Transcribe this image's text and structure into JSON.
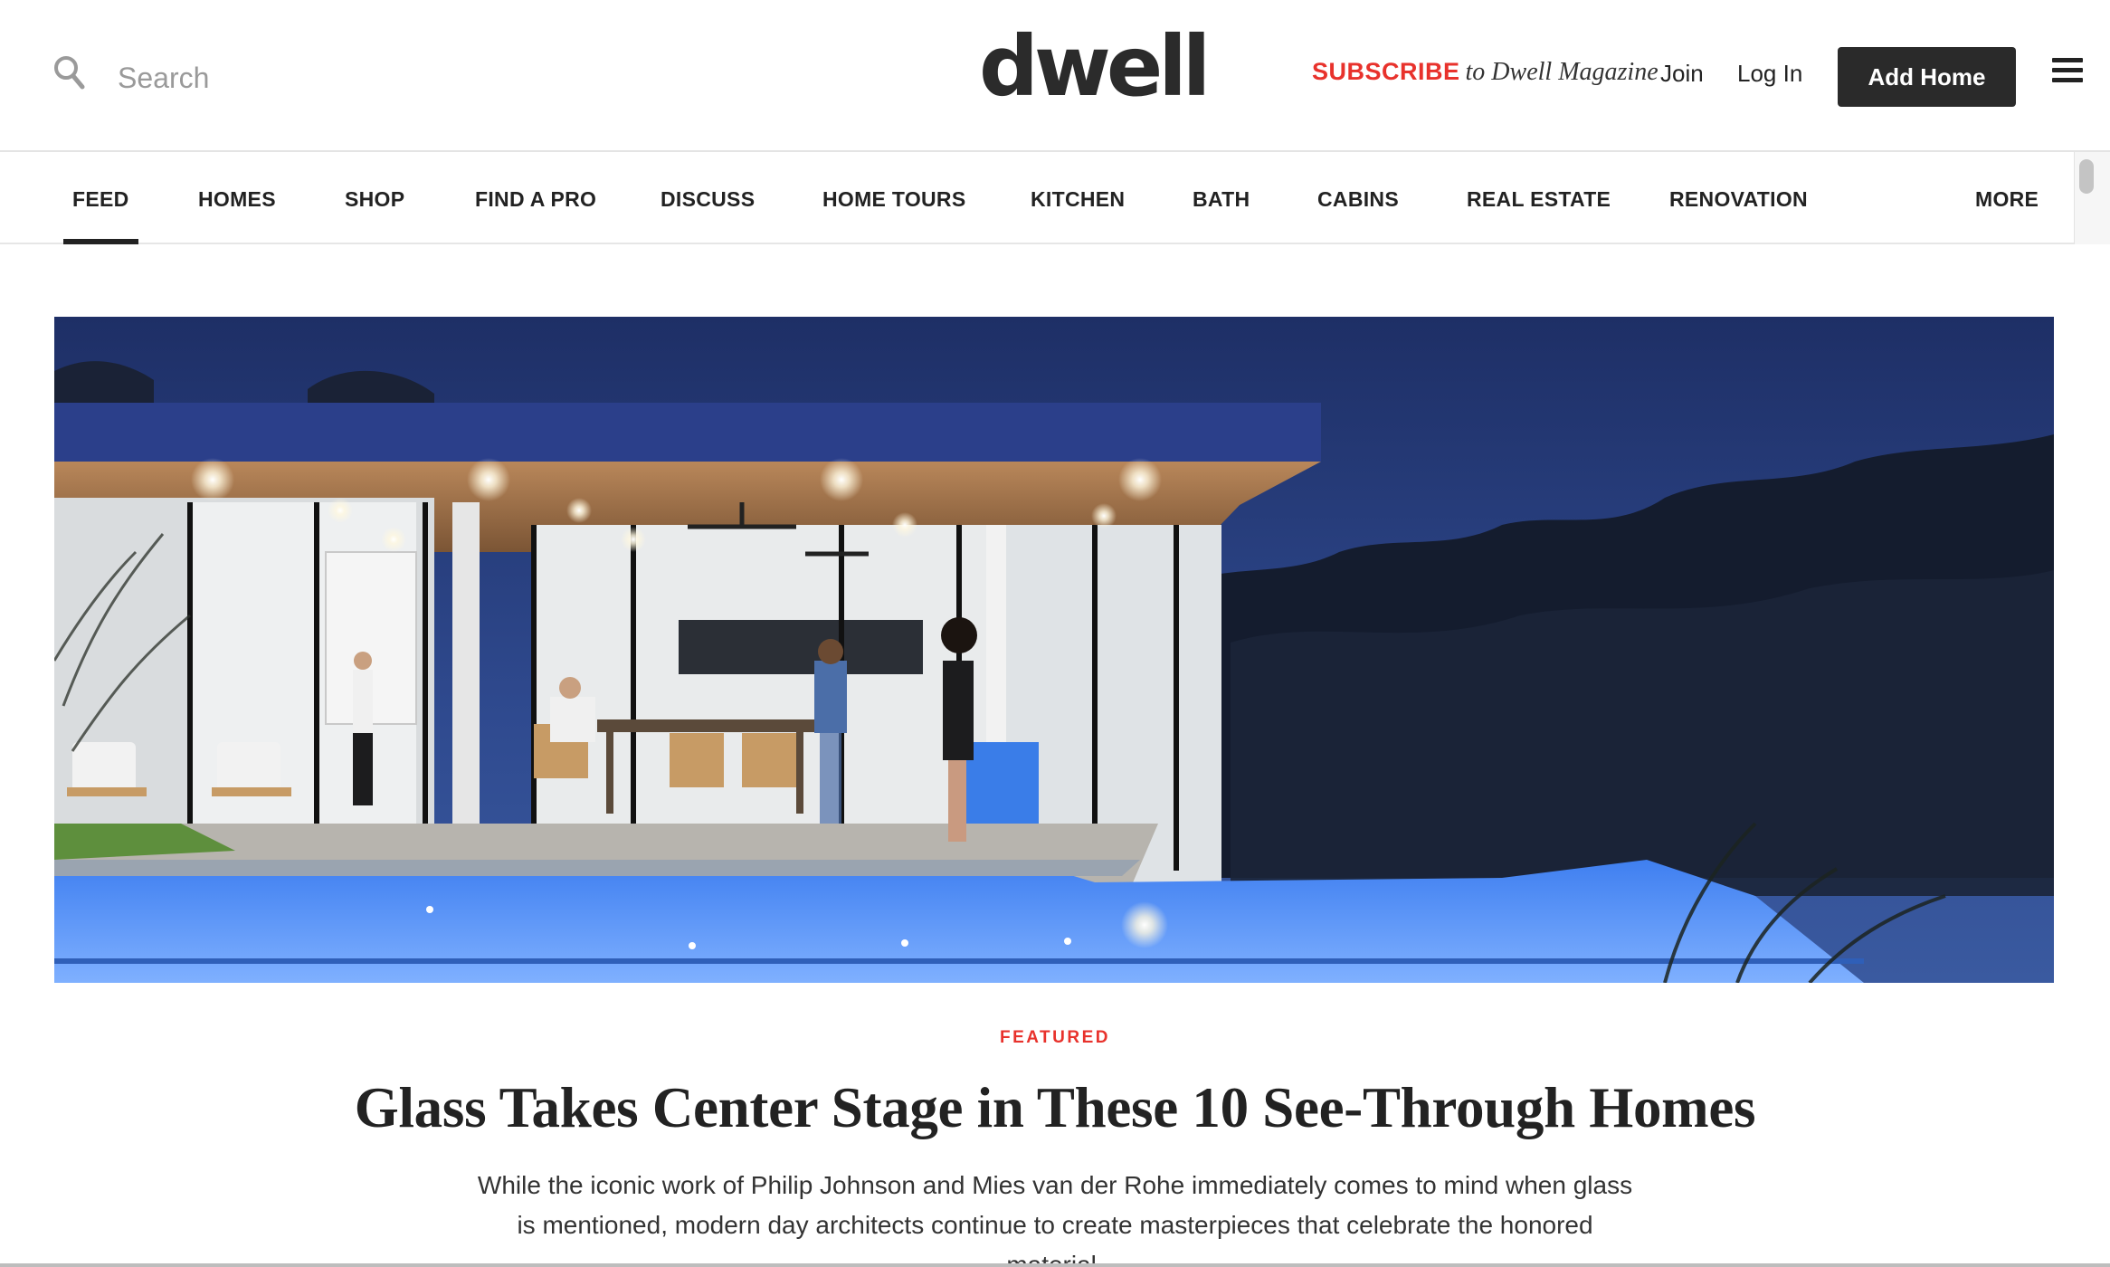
{
  "header": {
    "search_placeholder": "Search",
    "logo": "dwell",
    "subscribe_highlight": "SUBSCRIBE",
    "subscribe_rest": "to Dwell Magazine",
    "join_label": "Join",
    "login_label": "Log In",
    "add_home_label": "Add Home",
    "icons": {
      "search": "search-icon",
      "menu": "hamburger-menu-icon"
    }
  },
  "nav": {
    "items": [
      {
        "label": "FEED",
        "active": true
      },
      {
        "label": "HOMES"
      },
      {
        "label": "SHOP"
      },
      {
        "label": "FIND A PRO"
      },
      {
        "label": "DISCUSS"
      },
      {
        "label": "HOME TOURS"
      },
      {
        "label": "KITCHEN"
      },
      {
        "label": "BATH"
      },
      {
        "label": "CABINS"
      },
      {
        "label": "REAL ESTATE"
      },
      {
        "label": "RENOVATION"
      }
    ],
    "more_label": "MORE"
  },
  "hero": {
    "kicker": "FEATURED",
    "title": "Glass Takes Center Stage in These 10 See-Through Homes",
    "description": "While the iconic work of Philip Johnson and Mies van der Rohe immediately comes to mind when glass is mentioned, modern day architects continue to create masterpieces that celebrate the honored material."
  },
  "colors": {
    "accent_red": "#e8322c",
    "button_dark": "#2a2a2a",
    "text_dark": "#222222"
  }
}
